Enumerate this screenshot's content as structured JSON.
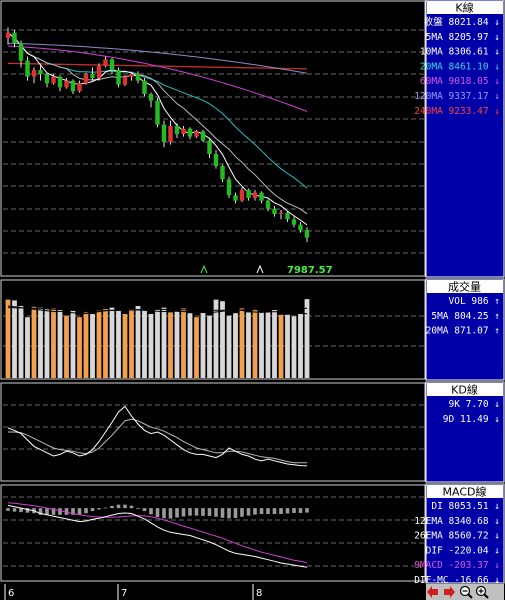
{
  "colors": {
    "background": "#000000",
    "grid": "#8a8a8a",
    "panel_blue": "#0000a8",
    "candle_up": "#e03030",
    "candle_down": "#22bb22",
    "volume_up": "#f0a050",
    "volume_down": "#d8d8d8",
    "ma5": "#ffffff",
    "ma20": "#22c0c0",
    "ma60": "#d040d0",
    "ma240": "#c03030",
    "price_label": "#44ee44",
    "white_text": "#ffffff"
  },
  "panels": {
    "kline": {
      "title": "K線",
      "rows": [
        {
          "label": "收盤",
          "value": "8021.84",
          "arrow": "↓",
          "color": "#ffffff"
        },
        {
          "label": "5MA",
          "value": "8205.97",
          "arrow": "↓",
          "color": "#ffffff"
        },
        {
          "label": "10MA",
          "value": "8306.61",
          "arrow": "↓",
          "color": "#ffffff"
        },
        {
          "label": "20MA",
          "value": "8461.10",
          "arrow": "↓",
          "color": "#33dddd"
        },
        {
          "label": "60MA",
          "value": "9018.05",
          "arrow": "↓",
          "color": "#dd55dd"
        },
        {
          "label": "120MA",
          "value": "9337.17",
          "arrow": "↓",
          "color": "#9a9aff"
        },
        {
          "label": "240MA",
          "value": "9233.47",
          "arrow": "↓",
          "color": "#ff4040"
        }
      ],
      "low_label": "7987.57"
    },
    "volume": {
      "title": "成交量",
      "rows": [
        {
          "label": "VOL",
          "value": "986",
          "arrow": "↑",
          "color": "#ffffff"
        },
        {
          "label": "5MA",
          "value": "804.25",
          "arrow": "↑",
          "color": "#ffffff"
        },
        {
          "label": "20MA",
          "value": "871.07",
          "arrow": "↑",
          "color": "#ffffff"
        }
      ]
    },
    "kd": {
      "title": "KD線",
      "rows": [
        {
          "label": "9K",
          "value": "7.70",
          "arrow": "↓",
          "color": "#ffffff"
        },
        {
          "label": "9D",
          "value": "11.49",
          "arrow": "↓",
          "color": "#ffffff"
        }
      ]
    },
    "macd": {
      "title": "MACD線",
      "rows": [
        {
          "label": "DI",
          "value": "8053.51",
          "arrow": "↓",
          "color": "#ffffff"
        },
        {
          "label": "12EMA",
          "value": "8340.68",
          "arrow": "↓",
          "color": "#ffffff"
        },
        {
          "label": "26EMA",
          "value": "8560.72",
          "arrow": "↓",
          "color": "#ffffff"
        },
        {
          "label": "DIF",
          "value": "-220.04",
          "arrow": "↓",
          "color": "#ffffff"
        },
        {
          "label": "9MACD",
          "value": "-203.37",
          "arrow": "↓",
          "color": "#dd55dd"
        },
        {
          "label": "DIF-MC",
          "value": "-16.66",
          "arrow": "↓",
          "color": "#ffffff"
        }
      ]
    }
  },
  "x_axis": {
    "labels": [
      "6",
      "7",
      "8"
    ]
  },
  "nav_icons": [
    "arrow-left-icon",
    "arrow-right-icon",
    "zoom-out-icon",
    "zoom-in-icon"
  ],
  "chart_data": {
    "type": "candlestick",
    "price_range": [
      7900,
      9700
    ],
    "candles": [
      [
        9520,
        9600,
        9470,
        9560
      ],
      [
        9560,
        9580,
        9450,
        9480
      ],
      [
        9480,
        9500,
        9300,
        9350
      ],
      [
        9350,
        9380,
        9200,
        9230
      ],
      [
        9230,
        9300,
        9180,
        9280
      ],
      [
        9280,
        9330,
        9200,
        9250
      ],
      [
        9250,
        9260,
        9150,
        9180
      ],
      [
        9180,
        9250,
        9170,
        9230
      ],
      [
        9230,
        9240,
        9120,
        9150
      ],
      [
        9150,
        9220,
        9140,
        9200
      ],
      [
        9200,
        9210,
        9100,
        9120
      ],
      [
        9120,
        9200,
        9110,
        9180
      ],
      [
        9180,
        9260,
        9170,
        9250
      ],
      [
        9250,
        9300,
        9200,
        9220
      ],
      [
        9220,
        9330,
        9200,
        9310
      ],
      [
        9310,
        9380,
        9300,
        9360
      ],
      [
        9360,
        9370,
        9250,
        9280
      ],
      [
        9280,
        9300,
        9150,
        9170
      ],
      [
        9170,
        9240,
        9160,
        9230
      ],
      [
        9230,
        9260,
        9200,
        9250
      ],
      [
        9250,
        9270,
        9180,
        9200
      ],
      [
        9200,
        9220,
        9080,
        9100
      ],
      [
        9100,
        9110,
        9000,
        9050
      ],
      [
        9050,
        9070,
        8850,
        8870
      ],
      [
        8870,
        8900,
        8700,
        8740
      ],
      [
        8740,
        8900,
        8720,
        8860
      ],
      [
        8860,
        8880,
        8770,
        8800
      ],
      [
        8800,
        8860,
        8780,
        8840
      ],
      [
        8840,
        8850,
        8760,
        8780
      ],
      [
        8780,
        8830,
        8770,
        8820
      ],
      [
        8820,
        8830,
        8740,
        8750
      ],
      [
        8750,
        8760,
        8620,
        8650
      ],
      [
        8650,
        8680,
        8540,
        8560
      ],
      [
        8560,
        8570,
        8440,
        8460
      ],
      [
        8460,
        8480,
        8320,
        8340
      ],
      [
        8340,
        8360,
        8280,
        8300
      ],
      [
        8300,
        8400,
        8290,
        8380
      ],
      [
        8380,
        8390,
        8300,
        8320
      ],
      [
        8320,
        8380,
        8300,
        8360
      ],
      [
        8360,
        8370,
        8280,
        8300
      ],
      [
        8300,
        8310,
        8220,
        8240
      ],
      [
        8240,
        8260,
        8180,
        8200
      ],
      [
        8200,
        8230,
        8160,
        8210
      ],
      [
        8210,
        8220,
        8140,
        8160
      ],
      [
        8160,
        8180,
        8100,
        8120
      ],
      [
        8120,
        8140,
        8060,
        8080
      ],
      [
        8080,
        8100,
        7988,
        8022
      ]
    ],
    "volume": {
      "max": 1000,
      "values": [
        980,
        970,
        900,
        760,
        890,
        880,
        860,
        870,
        860,
        780,
        840,
        760,
        820,
        800,
        850,
        860,
        880,
        840,
        800,
        860,
        900,
        850,
        800,
        860,
        880,
        820,
        830,
        870,
        810,
        760,
        820,
        780,
        980,
        960,
        780,
        810,
        870,
        820,
        860,
        820,
        830,
        850,
        790,
        790,
        770,
        800,
        986
      ],
      "ma5": [
        900,
        890,
        880,
        870,
        860,
        850,
        840,
        830,
        835,
        820,
        815,
        810,
        805,
        820,
        830,
        840,
        845,
        850,
        845,
        850,
        850,
        845,
        840,
        835,
        830,
        840,
        835,
        830,
        830,
        815,
        820,
        815,
        825,
        835,
        850,
        860,
        845,
        830,
        825,
        820,
        825,
        830,
        825,
        820,
        815,
        810,
        804
      ],
      "ma20": [
        880,
        878,
        876,
        874,
        872,
        870,
        866,
        860,
        856,
        852,
        848,
        845,
        842,
        840,
        840,
        842,
        845,
        848,
        850,
        852,
        855,
        856,
        857,
        858,
        858,
        857,
        855,
        853,
        852,
        850,
        848,
        847,
        846,
        846,
        847,
        849,
        851,
        853,
        855,
        857,
        859,
        861,
        863,
        865,
        866,
        868,
        871
      ]
    },
    "kd": {
      "range": [
        0,
        100
      ],
      "k": [
        55,
        52,
        48,
        40,
        32,
        28,
        24,
        20,
        22,
        26,
        24,
        20,
        22,
        28,
        38,
        50,
        62,
        75,
        82,
        70,
        60,
        52,
        48,
        50,
        46,
        40,
        34,
        28,
        24,
        22,
        22,
        20,
        18,
        22,
        30,
        26,
        22,
        20,
        16,
        14,
        16,
        14,
        12,
        10,
        9,
        8,
        7.7
      ],
      "d": [
        50,
        50,
        49,
        46,
        42,
        38,
        34,
        30,
        28,
        27,
        26,
        24,
        23,
        25,
        30,
        38,
        46,
        55,
        64,
        66,
        64,
        60,
        56,
        54,
        51,
        47,
        43,
        38,
        34,
        30,
        28,
        26,
        24,
        24,
        26,
        26,
        25,
        23,
        21,
        19,
        18,
        17,
        15,
        13,
        11.5,
        11.5,
        11.49
      ]
    },
    "macd": {
      "range": [
        -260,
        60
      ],
      "dif": [
        10,
        5,
        0,
        -5,
        -10,
        -20,
        -25,
        -30,
        -35,
        -40,
        -45,
        -50,
        -48,
        -42,
        -38,
        -32,
        -26,
        -20,
        -18,
        -20,
        -30,
        -40,
        -55,
        -70,
        -82,
        -90,
        -94,
        -98,
        -102,
        -110,
        -118,
        -126,
        -136,
        -148,
        -160,
        -168,
        -172,
        -176,
        -180,
        -186,
        -192,
        -198,
        -204,
        -208,
        -212,
        -216,
        -220.04
      ],
      "macd": [
        20,
        18,
        15,
        12,
        9,
        5,
        0,
        -5,
        -10,
        -15,
        -20,
        -25,
        -29,
        -31,
        -33,
        -34,
        -34,
        -33,
        -31,
        -29,
        -28,
        -29,
        -32,
        -37,
        -44,
        -51,
        -59,
        -67,
        -74,
        -82,
        -89,
        -97,
        -104,
        -112,
        -122,
        -131,
        -140,
        -148,
        -156,
        -164,
        -170,
        -176,
        -182,
        -188,
        -194,
        -198,
        -203.37
      ],
      "osc": [
        -10,
        -13,
        -15,
        -17,
        -19,
        -25,
        -25,
        -25,
        -25,
        -25,
        -25,
        -25,
        -19,
        -11,
        -5,
        2,
        8,
        13,
        13,
        9,
        -2,
        -11,
        -23,
        -33,
        -38,
        -39,
        -35,
        -31,
        -28,
        -28,
        -29,
        -29,
        -32,
        -36,
        -38,
        -37,
        -32,
        -28,
        -24,
        -22,
        -22,
        -22,
        -22,
        -20,
        -18,
        -18,
        -16.66
      ]
    }
  }
}
